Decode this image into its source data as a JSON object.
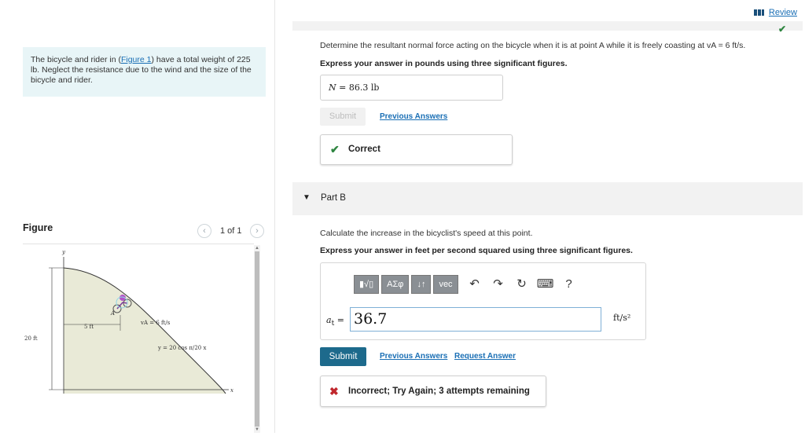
{
  "problem": {
    "text_before": "The bicycle and rider in (",
    "figure_link": "Figure 1",
    "text_after": ") have a total weight of 225 lb. Neglect the resistance due to the wind and the size of the bicycle and rider."
  },
  "figure": {
    "label": "Figure",
    "pager": "1 of 1",
    "labels": {
      "y_axis": "y",
      "x_axis": "x",
      "point": "A",
      "height": "20 ft",
      "offset": "5 ft",
      "speed": "vA = 6 ft/s",
      "curve": "y = 20 cos π/20 x"
    }
  },
  "header": {
    "review": "Review"
  },
  "part_a": {
    "question": "Determine the resultant normal force acting on the bicycle when it is at point A while it is freely coasting at vA = 6 ft/s.",
    "instructions": "Express your answer in pounds using three significant figures.",
    "answer_var": "N",
    "answer_eq": " = ",
    "answer_value": "86.3",
    "answer_unit": "lb",
    "submit": "Submit",
    "previous_answers": "Previous Answers",
    "feedback": "Correct"
  },
  "part_b": {
    "label": "Part B",
    "question": "Calculate the increase in the bicyclist's speed at this point.",
    "instructions": "Express your answer in feet per second squared using three significant figures.",
    "toolbar": {
      "templates": "▮√▯",
      "symbols": "ΑΣφ",
      "arrows": "↓↑",
      "vec": "vec"
    },
    "answer_label_var": "a",
    "answer_label_sub": "t",
    "answer_label_eq": " =",
    "answer_value": "36.7",
    "unit": "ft/s²",
    "submit": "Submit",
    "previous_answers": "Previous Answers",
    "request_answer": "Request Answer",
    "feedback": "Incorrect; Try Again; 3 attempts remaining"
  },
  "colors": {
    "link": "#1a6fb5",
    "correct": "#2e8540",
    "incorrect": "#c0272d",
    "submit_active": "#1d6a8c",
    "problem_bg": "#e8f5f7"
  }
}
